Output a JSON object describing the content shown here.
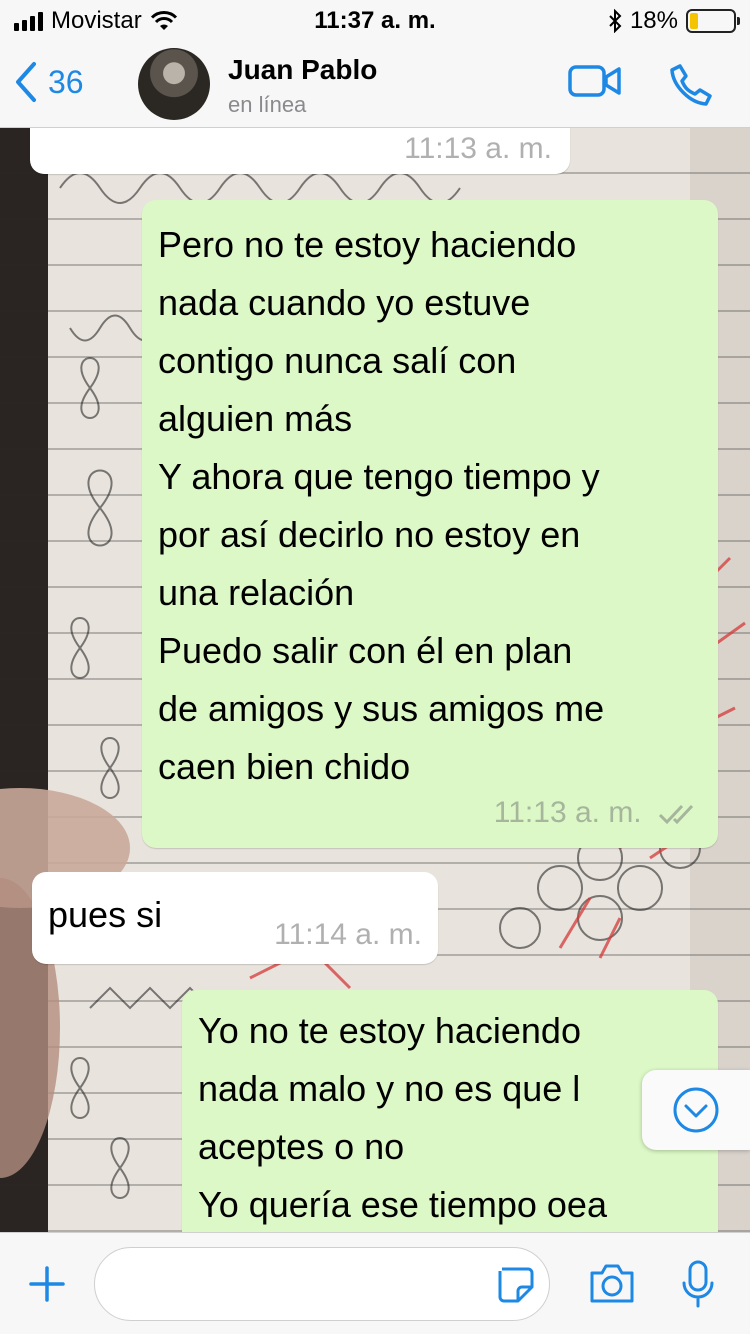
{
  "status_bar": {
    "carrier": "Movistar",
    "time": "11:37 a. m.",
    "battery": "18%",
    "battery_level": 0.18
  },
  "header": {
    "back_count": "36",
    "contact_name": "Juan Pablo",
    "contact_status": "en línea",
    "icons": [
      "back-chevron-icon",
      "video-call-icon",
      "phone-icon"
    ]
  },
  "messages": [
    {
      "direction": "in",
      "text": "",
      "time": "11:13 a. m."
    },
    {
      "direction": "out",
      "text": "Pero no te estoy haciendo\nnada cuando yo estuve\ncontigo nunca salí con\nalguien más\nY ahora que tengo tiempo y\npor así decirlo no estoy en\nuna relación\nPuedo salir con él en plan\nde amigos y sus amigos me\ncaen bien chido",
      "time": "11:13 a. m.",
      "status": "read"
    },
    {
      "direction": "in",
      "text": "pues si",
      "time": "11:14 a. m."
    },
    {
      "direction": "out",
      "text": "Yo no te estoy haciendo\nnada malo y no es que l\naceptes o no\nYo quería ese tiempo oea",
      "time": ""
    }
  ],
  "composer": {
    "value": "",
    "icons": [
      "plus-icon",
      "sticker-icon",
      "camera-icon",
      "microphone-icon"
    ]
  },
  "colors": {
    "accent": "#1e88e5",
    "outgoing_bubble": "#dcf8c6",
    "incoming_bubble": "#ffffff",
    "battery_fill": "#f5c400"
  }
}
